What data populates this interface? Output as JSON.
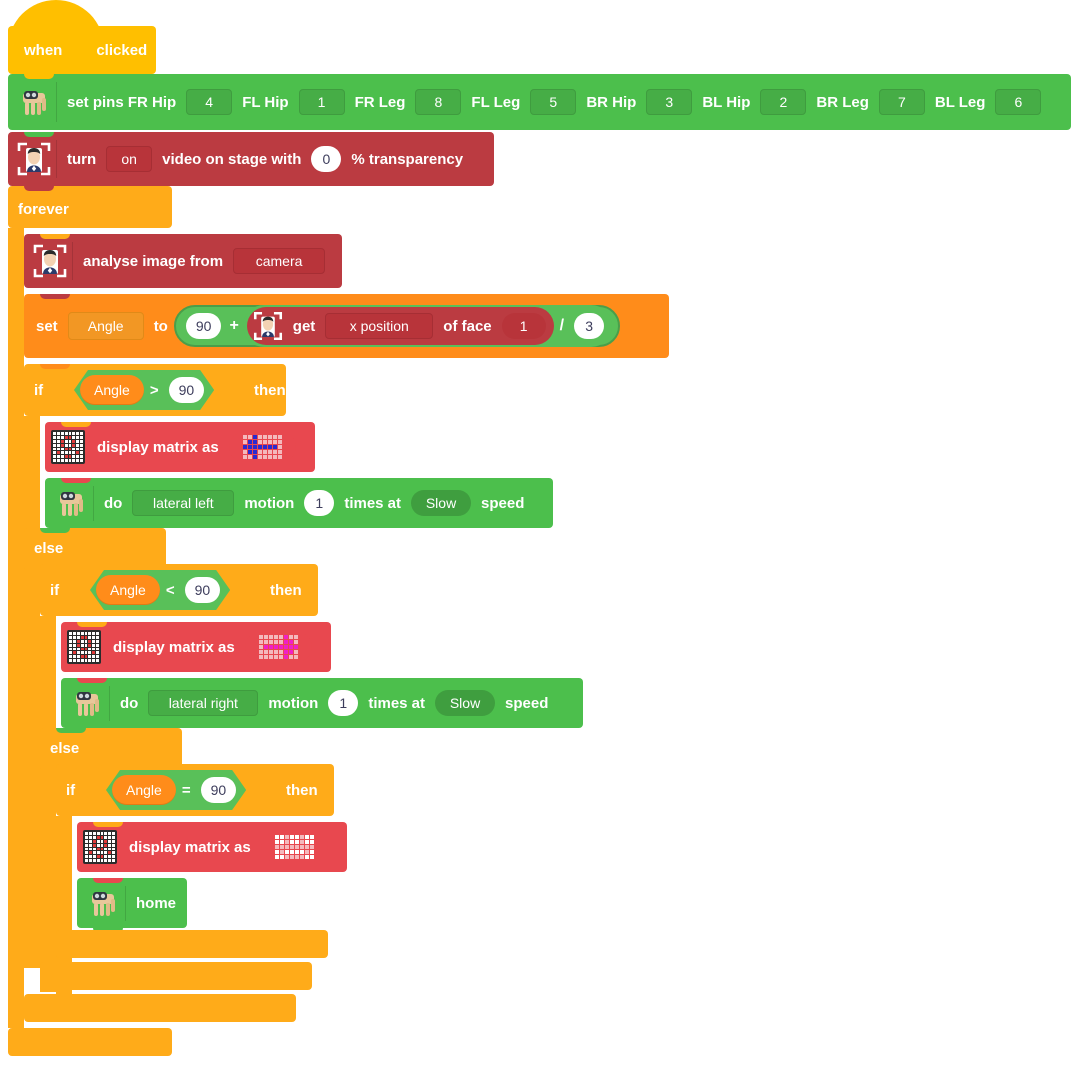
{
  "script": {
    "hat": {
      "when_label": "when",
      "flag_icon": "green-flag-icon",
      "clicked_label": "clicked"
    },
    "set_pins": {
      "icon": "robot-dog-icon",
      "label": "set pins FR Hip",
      "pins": [
        {
          "name": "FR Hip",
          "value": "4"
        },
        {
          "name": "FL Hip",
          "value": "1"
        },
        {
          "name": "FR Leg",
          "value": "8"
        },
        {
          "name": "FL Leg",
          "value": "5"
        },
        {
          "name": "BR Hip",
          "value": "3"
        },
        {
          "name": "BL Hip",
          "value": "2"
        },
        {
          "name": "BR Leg",
          "value": "7"
        },
        {
          "name": "BL Leg",
          "value": "6"
        }
      ]
    },
    "turn_video": {
      "icon": "face-detect-icon",
      "turn_label": "turn",
      "state": "on",
      "mid_label": "video on stage with",
      "transparency": "0",
      "tail_label": "% transparency"
    },
    "forever": {
      "label": "forever"
    },
    "analyse_image": {
      "icon": "face-detect-icon",
      "label": "analyse image from",
      "source": "camera"
    },
    "set_angle": {
      "set_label": "set",
      "variable": "Angle",
      "to_label": "to",
      "addend": "90",
      "plus_symbol": "+",
      "get_label": "get",
      "attribute": "x position",
      "of_face_label": "of face",
      "face_index": "1",
      "divide_symbol": "/",
      "divisor": "3"
    },
    "if1": {
      "if_label": "if",
      "left_operand": "Angle",
      "operator": ">",
      "right_operand": "90",
      "then_label": "then",
      "else_label": "else",
      "display_matrix": {
        "icon": "led-matrix-icon",
        "label": "display matrix as",
        "pattern_name": "arrow-left",
        "pattern_color": "#2a2ad0",
        "pattern": [
          [
            0,
            0,
            1,
            0,
            0,
            0,
            0,
            0
          ],
          [
            0,
            1,
            1,
            0,
            0,
            0,
            0,
            0
          ],
          [
            1,
            1,
            1,
            1,
            1,
            1,
            1,
            0
          ],
          [
            0,
            1,
            1,
            0,
            0,
            0,
            0,
            0
          ],
          [
            0,
            0,
            1,
            0,
            0,
            0,
            0,
            0
          ]
        ]
      },
      "do_motion": {
        "icon": "robot-dog-icon",
        "do_label": "do",
        "motion": "lateral left",
        "motion_label": "motion",
        "times": "1",
        "times_at_label": "times at",
        "speed": "Slow",
        "speed_label": "speed"
      }
    },
    "if2": {
      "if_label": "if",
      "left_operand": "Angle",
      "operator": "<",
      "right_operand": "90",
      "then_label": "then",
      "else_label": "else",
      "display_matrix": {
        "icon": "led-matrix-icon",
        "label": "display matrix as",
        "pattern_name": "arrow-right",
        "pattern_color": "#f020c8",
        "pattern": [
          [
            0,
            0,
            0,
            0,
            0,
            1,
            0,
            0
          ],
          [
            0,
            0,
            0,
            0,
            0,
            1,
            1,
            0
          ],
          [
            0,
            1,
            1,
            1,
            1,
            1,
            1,
            1
          ],
          [
            0,
            0,
            0,
            0,
            0,
            1,
            1,
            0
          ],
          [
            0,
            0,
            0,
            0,
            0,
            1,
            0,
            0
          ]
        ]
      },
      "do_motion": {
        "icon": "robot-dog-icon",
        "do_label": "do",
        "motion": "lateral right",
        "motion_label": "motion",
        "times": "1",
        "times_at_label": "times at",
        "speed": "Slow",
        "speed_label": "speed"
      }
    },
    "if3": {
      "if_label": "if",
      "left_operand": "Angle",
      "operator": "=",
      "right_operand": "90",
      "then_label": "then",
      "home_label": "home",
      "display_matrix": {
        "icon": "led-matrix-icon",
        "label": "display matrix as",
        "pattern_name": "smiley",
        "pattern_color": "#ffffff",
        "pattern": [
          [
            1,
            1,
            0,
            1,
            1,
            0,
            1,
            1
          ],
          [
            1,
            1,
            0,
            1,
            1,
            0,
            1,
            1
          ],
          [
            0,
            0,
            0,
            0,
            0,
            0,
            0,
            0
          ],
          [
            1,
            0,
            1,
            1,
            1,
            1,
            0,
            1
          ],
          [
            1,
            1,
            0,
            0,
            0,
            0,
            1,
            1
          ]
        ]
      }
    }
  },
  "palette": {
    "hat_yellow": "#FFBF00",
    "control_orange": "#FFAB19",
    "variables_orange": "#FF8C1A",
    "robot_green": "#4CBF4C",
    "operators_green": "#59C059",
    "video_red": "#BB3B41",
    "matrix_pink": "#E8484F",
    "background": "#FFFFFF"
  }
}
